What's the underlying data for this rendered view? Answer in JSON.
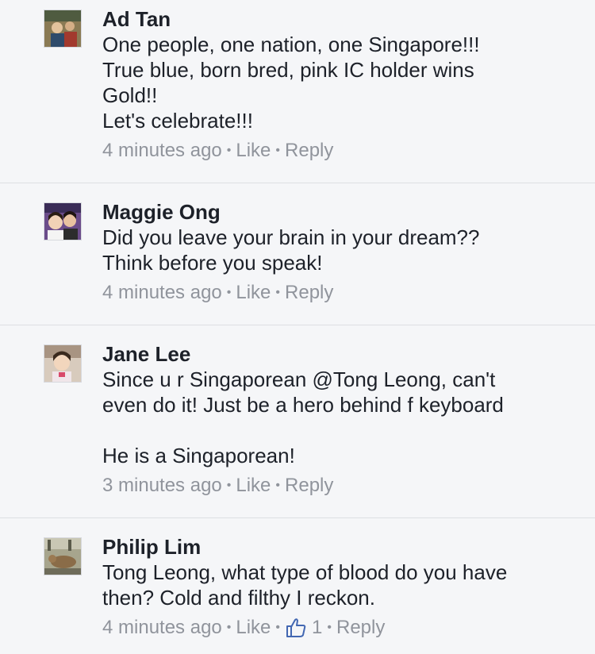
{
  "comments": [
    {
      "name": "Ad Tan",
      "body": "One people, one nation, one Singapore!!!\nTrue blue, born bred, pink IC holder wins\nGold!!\nLet's celebrate!!!",
      "time": "4 minutes ago",
      "like_label": "Like",
      "reply_label": "Reply",
      "avatar_bg": "#8a7a54"
    },
    {
      "name": "Maggie Ong",
      "body": "Did you leave your brain in your dream??\nThink before you speak!",
      "time": "4 minutes ago",
      "like_label": "Like",
      "reply_label": "Reply",
      "avatar_bg": "#6b4c8a"
    },
    {
      "name": "Jane Lee",
      "body": "Since u r Singaporean @Tong Leong, can't\neven do it! Just be a hero behind f keyboard\n\nHe is a Singaporean!",
      "time": "3 minutes ago",
      "like_label": "Like",
      "reply_label": "Reply",
      "avatar_bg": "#c9a98a"
    },
    {
      "name": "Philip Lim",
      "body": "Tong Leong, what type of blood do you have\nthen? Cold and filthy I reckon.",
      "time": "4 minutes ago",
      "like_label": "Like",
      "reactions_count": "1",
      "reply_label": "Reply",
      "avatar_bg": "#7d8a6a"
    }
  ],
  "icons": {
    "thumbs_up": "thumbs-up-icon"
  },
  "colors": {
    "background": "#f5f6f8",
    "meta_text": "#90949c",
    "accent": "#4267b2"
  }
}
